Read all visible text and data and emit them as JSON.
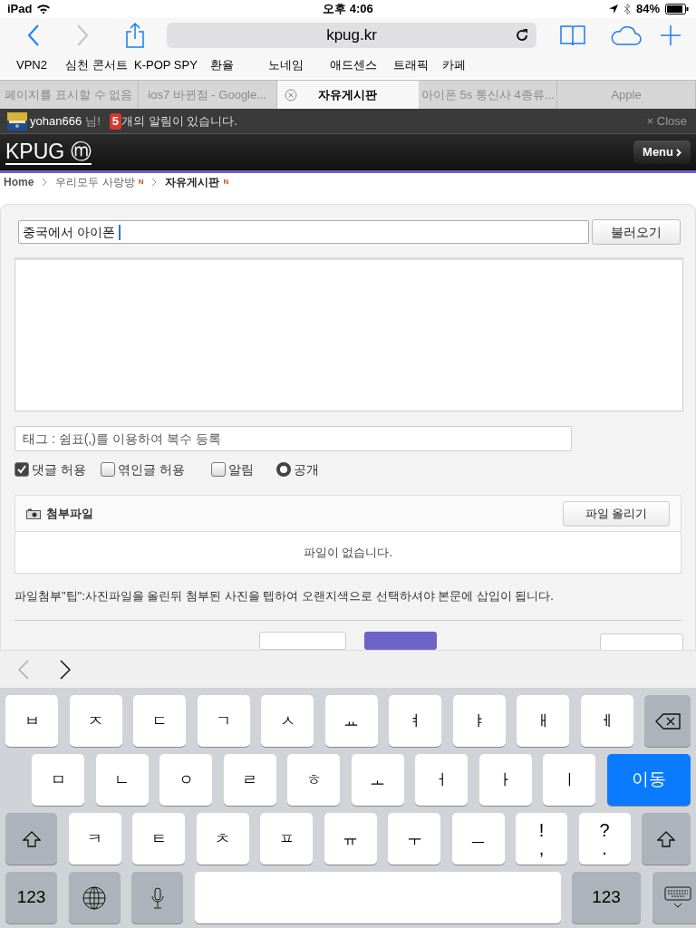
{
  "status_bar": {
    "device": "iPad",
    "time": "오후 4:06",
    "battery": "84%"
  },
  "toolbar": {
    "url": "kpug.kr"
  },
  "bookmarks": [
    "VPN2",
    "심천 콘서트",
    "K-POP SPY",
    "환율",
    "노네임",
    "애드센스",
    "트래픽",
    "카페"
  ],
  "tabs": [
    {
      "label": "페이지를 표시할 수 없음",
      "selected": false
    },
    {
      "label": "ios7 바뀐점 - Google...",
      "selected": false
    },
    {
      "label": "자유게시판",
      "selected": true
    },
    {
      "label": "아이폰 5s 통신사 4종류...",
      "selected": false
    },
    {
      "label": "Apple",
      "selected": false
    }
  ],
  "notice": {
    "user": "yohan666",
    "suffix": "님!",
    "count": "5",
    "message": "개의 알림이 있습니다.",
    "close": "× Close"
  },
  "site": {
    "logo": "KPUG ⓜ",
    "menu": "Menu"
  },
  "breadcrumb": [
    {
      "kind": "home",
      "label": "Home",
      "current": false
    },
    {
      "label": "우리모두 사랑방",
      "new_mark": "N",
      "current": false
    },
    {
      "label": "자유게시판",
      "new_mark": "N",
      "current": true
    }
  ],
  "form": {
    "title_value": "중국에서 아이폰",
    "load_button": "불러오기",
    "tag_placeholder": "태그 : 쉼표(,)를 이용하여 복수 등록",
    "options": [
      {
        "kind": "checkbox",
        "label": "댓글 허용",
        "checked": true
      },
      {
        "kind": "checkbox",
        "label": "엮인글 허용",
        "checked": false
      },
      {
        "kind": "checkbox",
        "label": "알림",
        "checked": false
      },
      {
        "kind": "radio",
        "label": "공개",
        "checked": true
      }
    ],
    "attachments": {
      "title": "첨부파일",
      "upload_button": "파일 올리기",
      "empty": "파일이 없습니다."
    },
    "tip": "파일첨부\"팁\":사진파일을 올린뒤 첨부된 사진을 텝하여 오랜지색으로 선택하셔야 본문에 삽입이 됩니다."
  },
  "keyboard": {
    "rows": [
      {
        "keys": [
          {
            "kind": "letter",
            "label": "ㅂ"
          },
          {
            "kind": "letter",
            "label": "ㅈ"
          },
          {
            "kind": "letter",
            "label": "ㄷ"
          },
          {
            "kind": "letter",
            "label": "ㄱ"
          },
          {
            "kind": "letter",
            "label": "ㅅ"
          },
          {
            "kind": "letter",
            "label": "ㅛ"
          },
          {
            "kind": "letter",
            "label": "ㅕ"
          },
          {
            "kind": "letter",
            "label": "ㅑ"
          },
          {
            "kind": "letter",
            "label": "ㅐ"
          },
          {
            "kind": "letter",
            "label": "ㅔ"
          },
          {
            "kind": "backspace"
          }
        ]
      },
      {
        "keys": [
          {
            "kind": "letter",
            "label": "ㅁ"
          },
          {
            "kind": "letter",
            "label": "ㄴ"
          },
          {
            "kind": "letter",
            "label": "ㅇ"
          },
          {
            "kind": "letter",
            "label": "ㄹ"
          },
          {
            "kind": "letter",
            "label": "ㅎ"
          },
          {
            "kind": "letter",
            "label": "ㅗ"
          },
          {
            "kind": "letter",
            "label": "ㅓ"
          },
          {
            "kind": "letter",
            "label": "ㅏ"
          },
          {
            "kind": "letter",
            "label": "ㅣ"
          },
          {
            "kind": "go",
            "label": "이동"
          }
        ]
      },
      {
        "keys": [
          {
            "kind": "shift"
          },
          {
            "kind": "letter",
            "label": "ㅋ"
          },
          {
            "kind": "letter",
            "label": "ㅌ"
          },
          {
            "kind": "letter",
            "label": "ㅊ"
          },
          {
            "kind": "letter",
            "label": "ㅍ"
          },
          {
            "kind": "letter",
            "label": "ㅠ"
          },
          {
            "kind": "letter",
            "label": "ㅜ"
          },
          {
            "kind": "letter",
            "label": "ㅡ"
          },
          {
            "kind": "punct",
            "label": "!",
            "sub": ","
          },
          {
            "kind": "punct",
            "label": "?",
            "sub": "."
          },
          {
            "kind": "shift"
          }
        ]
      },
      {
        "keys": [
          {
            "kind": "number",
            "label": "123"
          },
          {
            "kind": "globe"
          },
          {
            "kind": "mic"
          },
          {
            "kind": "space"
          },
          {
            "kind": "number",
            "label": "123"
          },
          {
            "kind": "hide"
          }
        ]
      }
    ]
  }
}
